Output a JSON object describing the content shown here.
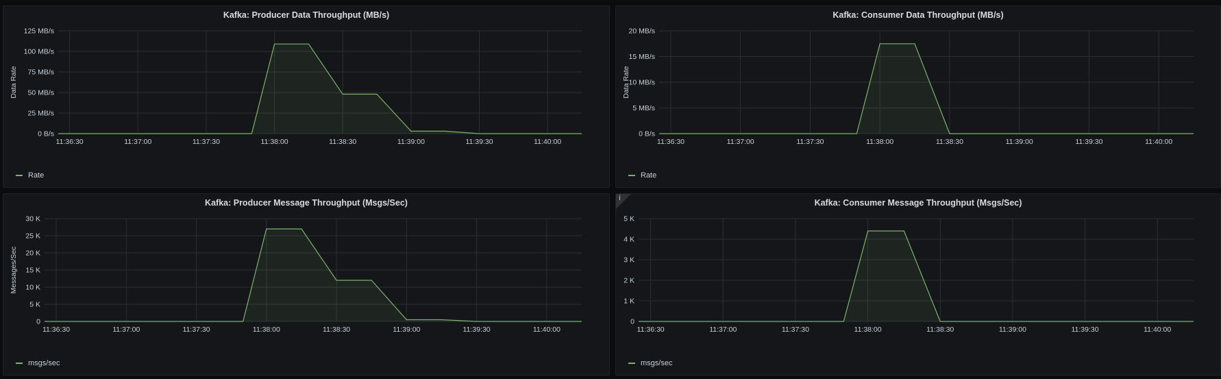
{
  "colors": {
    "series": "#7eb26d",
    "grid": "#2c3033",
    "background": "#141619"
  },
  "chart_data": [
    {
      "type": "area",
      "title": "Kafka: Producer Data Throughput (MB/s)",
      "ylabel": "Data Rate",
      "yticks": [
        "0 B/s",
        "25 MB/s",
        "50 MB/s",
        "75 MB/s",
        "100 MB/s",
        "125 MB/s"
      ],
      "ylim": [
        0,
        125
      ],
      "xticks": [
        "11:36:30",
        "11:37:00",
        "11:37:30",
        "11:38:00",
        "11:38:30",
        "11:39:00",
        "11:39:30",
        "11:40:00"
      ],
      "x_range": [
        "11:36:25",
        "11:40:15"
      ],
      "series": [
        {
          "name": "Rate",
          "x": [
            "11:36:25",
            "11:37:50",
            "11:38:00",
            "11:38:15",
            "11:38:30",
            "11:38:45",
            "11:39:00",
            "11:39:15",
            "11:39:30",
            "11:40:15"
          ],
          "values": [
            0,
            0,
            109,
            109,
            48,
            48,
            3,
            3,
            0,
            0
          ]
        }
      ],
      "legend_position": "bottom-left",
      "grid": true
    },
    {
      "type": "area",
      "title": "Kafka: Consumer Data Throughput (MB/s)",
      "ylabel": "Data Rate",
      "yticks": [
        "0 B/s",
        "5 MB/s",
        "10 MB/s",
        "15 MB/s",
        "20 MB/s"
      ],
      "ylim": [
        0,
        20
      ],
      "xticks": [
        "11:36:30",
        "11:37:00",
        "11:37:30",
        "11:38:00",
        "11:38:30",
        "11:39:00",
        "11:39:30",
        "11:40:00"
      ],
      "x_range": [
        "11:36:25",
        "11:40:15"
      ],
      "series": [
        {
          "name": "Rate",
          "x": [
            "11:36:25",
            "11:37:50",
            "11:38:00",
            "11:38:15",
            "11:38:30",
            "11:40:15"
          ],
          "values": [
            0,
            0,
            17.5,
            17.5,
            0,
            0
          ]
        }
      ],
      "legend_position": "bottom-left",
      "grid": true
    },
    {
      "type": "area",
      "title": "Kafka: Producer Message Throughput (Msgs/Sec)",
      "ylabel": "Messages/Sec",
      "yticks": [
        "0",
        "5 K",
        "10 K",
        "15 K",
        "20 K",
        "25 K",
        "30 K"
      ],
      "ylim": [
        0,
        30000
      ],
      "xticks": [
        "11:36:30",
        "11:37:00",
        "11:37:30",
        "11:38:00",
        "11:38:30",
        "11:39:00",
        "11:39:30",
        "11:40:00"
      ],
      "x_range": [
        "11:36:25",
        "11:40:15"
      ],
      "series": [
        {
          "name": "msgs/sec",
          "x": [
            "11:36:25",
            "11:37:50",
            "11:38:00",
            "11:38:15",
            "11:38:30",
            "11:38:45",
            "11:39:00",
            "11:39:15",
            "11:39:30",
            "11:40:15"
          ],
          "values": [
            0,
            0,
            27000,
            27000,
            12000,
            12000,
            500,
            500,
            0,
            0
          ]
        }
      ],
      "legend_position": "bottom-left",
      "grid": true
    },
    {
      "type": "area",
      "title": "Kafka: Consumer Message Throughput (Msgs/Sec)",
      "ylabel": "",
      "yticks": [
        "0",
        "1 K",
        "2 K",
        "3 K",
        "4 K",
        "5 K"
      ],
      "ylim": [
        0,
        5000
      ],
      "xticks": [
        "11:36:30",
        "11:37:00",
        "11:37:30",
        "11:38:00",
        "11:38:30",
        "11:39:00",
        "11:39:30",
        "11:40:00"
      ],
      "x_range": [
        "11:36:25",
        "11:40:15"
      ],
      "series": [
        {
          "name": "msgs/sec",
          "x": [
            "11:36:25",
            "11:37:50",
            "11:38:00",
            "11:38:15",
            "11:38:30",
            "11:40:15"
          ],
          "values": [
            0,
            0,
            4400,
            4400,
            0,
            0
          ]
        }
      ],
      "legend_position": "bottom-left",
      "grid": true,
      "info_icon": "info-icon"
    }
  ]
}
